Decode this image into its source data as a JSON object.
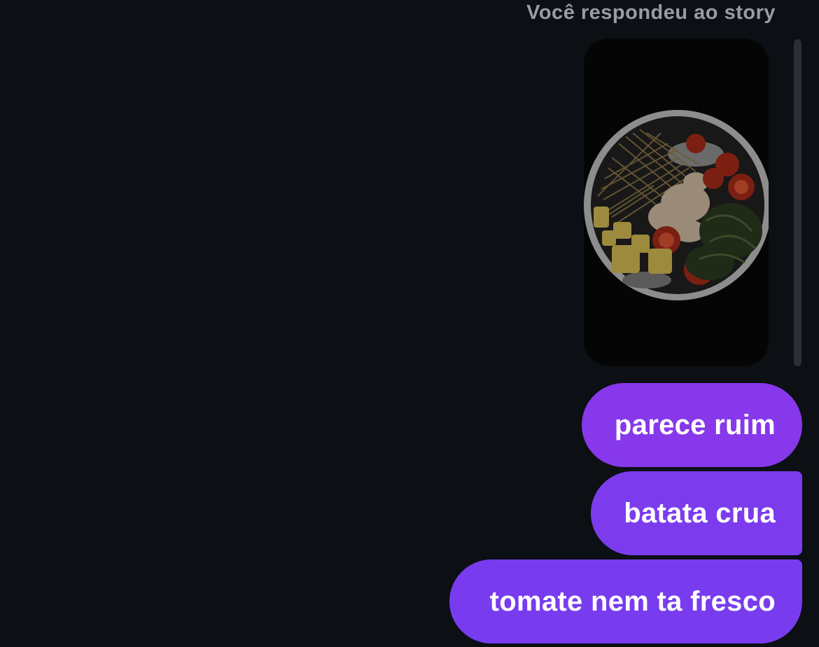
{
  "story_reply": {
    "label": "Você respondeu ao story",
    "image_subject": "salad bowl photo"
  },
  "messages": [
    {
      "text": "parece ruim"
    },
    {
      "text": "batata crua"
    },
    {
      "text": "tomate nem ta fresco"
    }
  ],
  "colors": {
    "background": "#0c0f14",
    "bubble": "#7c3cee",
    "label": "#9a9ca3"
  }
}
